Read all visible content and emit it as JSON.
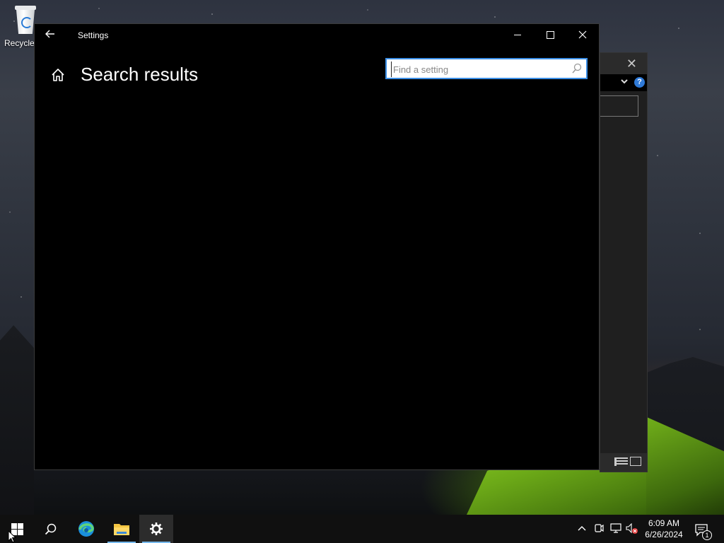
{
  "desktop": {
    "icons": [
      {
        "label": "Recycle Bin",
        "icon": "recycle-bin-icon"
      }
    ]
  },
  "background_window": {
    "close_symbol": "✕",
    "help_symbol": "?"
  },
  "settings_window": {
    "title": "Settings",
    "page_title": "Search results",
    "search": {
      "placeholder": "Find a setting",
      "value": ""
    },
    "buttons": {
      "back": "back-arrow-icon",
      "minimize": "minimize-icon",
      "maximize": "maximize-icon",
      "close": "close-icon"
    }
  },
  "taskbar": {
    "items": [
      "start",
      "search",
      "edge",
      "file-explorer",
      "settings"
    ],
    "active_item": "settings",
    "tray": {
      "time": "6:09 AM",
      "date": "6/26/2024",
      "notification_count": "1"
    }
  },
  "colors": {
    "accent": "#3a8ee6",
    "taskbar": "#101010",
    "window_bg": "#000000",
    "active_underline": "#76b9ed"
  }
}
